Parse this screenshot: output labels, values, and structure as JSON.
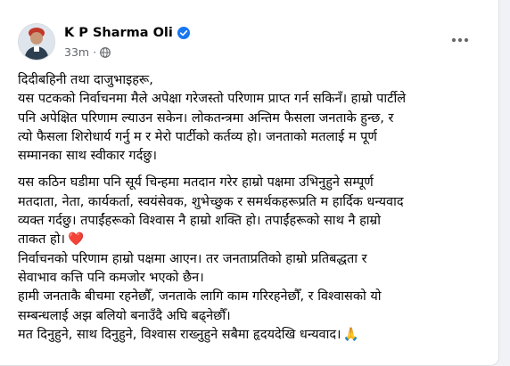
{
  "post": {
    "author": "K P Sharma Oli",
    "time": "33m",
    "meta_separator": "·",
    "icons": {
      "verified": "verified-badge-icon",
      "audience": "globe-icon",
      "more": "more-options-icon",
      "emoji_heart": "red-heart-emoji",
      "emoji_pray": "folded-hands-emoji"
    },
    "colors": {
      "verified": "#1877f2",
      "meta": "#65676b",
      "text": "#050505"
    },
    "paragraph1": "दिदीबहिनी तथा दाजुभाइहरू,\nयस पटकको निर्वाचनमा मैले अपेक्षा गरेजस्तो परिणाम प्राप्त गर्न सकिनँ। हाम्रो पार्टीले\nपनि अपेक्षित परिणाम ल्याउन सकेन। लोकतन्त्रमा अन्तिम फैसला जनताके हुन्छ, र\nत्यो फैसला शिरोधार्य गर्नु म र मेरो पार्टीको कर्तव्य हो। जनताको मतलाई म पूर्ण\nसम्मानका साथ स्वीकार गर्दछु।",
    "paragraph2_main": "यस कठिन घडीमा पनि सूर्य चिन्हमा मतदान गरेर हाम्रो पक्षमा उभिनुहुने सम्पूर्ण\nमतदाता, नेता, कार्यकर्ता, स्वयंसेवक, शुभेच्छुक र समर्थकहरूप्रति म हार्दिक धन्यवाद\nव्यक्त गर्दछु। तपाईंहरूको विश्वास नै हाम्रो शक्ति हो। तपाईंहरूको साथ नै हाम्रो\nताकत हो।",
    "heart": "❤️",
    "paragraph3": "निर्वाचनको परिणाम हाम्रो पक्षमा आएन। तर जनताप्रतिको हाम्रो प्रतिबद्धता र\nसेवाभाव कत्ति पनि कमजोर भएको छैन।\nहामी जनताकै बीचमा रहनेछौँ, जनताके लागि काम गरिरहनेछौँ, र विश्वासको यो\nसम्बन्धलाई अझ बलियो बनाउँदै अघि बढ्नेछौँ।",
    "paragraph4": "मत दिनुहुने, साथ दिनुहुने, विश्वास राख्नुहुने सबैमा हृदयदेखि धन्यवाद।",
    "pray": "🙏"
  }
}
